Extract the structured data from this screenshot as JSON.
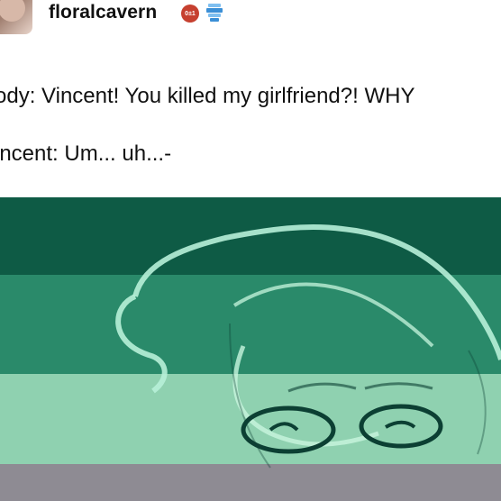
{
  "post": {
    "username": "floralcavern",
    "badges": [
      {
        "icon": "red-hexagon-badge-icon",
        "text": "0±1",
        "color": "#c6402f"
      },
      {
        "icon": "blue-stacked-badge-icon",
        "color": "#3b8fd6"
      }
    ]
  },
  "dialogue": {
    "line1": "ody: Vincent! You killed my girlfriend?! WHY",
    "line2": "incent: Um... uh...-"
  },
  "image": {
    "icon": "cartoon-face-illustration-icon",
    "stripes": [
      "#0e5b45",
      "#2a8a6a",
      "#8fd1b0",
      "#a9c9b8",
      "#8e8b93"
    ]
  }
}
